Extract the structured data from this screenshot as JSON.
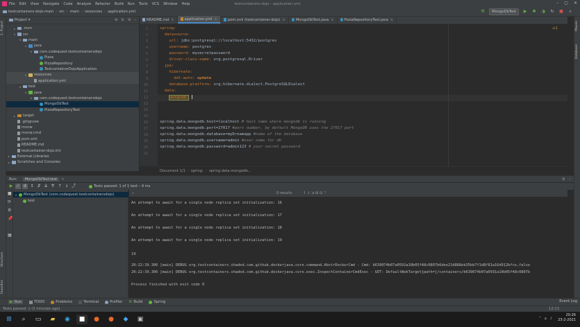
{
  "menubar": {
    "items": [
      "File",
      "Edit",
      "View",
      "Navigate",
      "Code",
      "Analyze",
      "Refactor",
      "Build",
      "Run",
      "Tools",
      "VCS",
      "Window",
      "Help"
    ],
    "window_title": "testcontainers-dojo - application.yml"
  },
  "navbar": {
    "crumbs": [
      "testcontainers-dojo-main",
      "src",
      "main",
      "resources",
      "application.yml"
    ],
    "run_config": "MongoDbTest"
  },
  "project": {
    "title": "Project",
    "tree": [
      {
        "label": ".mvn",
        "depth": 1,
        "icon": "folder"
      },
      {
        "label": "src",
        "depth": 1,
        "icon": "folder"
      },
      {
        "label": "main",
        "depth": 2,
        "icon": "folder"
      },
      {
        "label": "java",
        "depth": 3,
        "icon": "folder-blue"
      },
      {
        "label": "com.codequest.testcontainersdojo",
        "depth": 4,
        "icon": "folder"
      },
      {
        "label": "Pizza",
        "depth": 5,
        "icon": "class"
      },
      {
        "label": "PizzaRepository",
        "depth": 5,
        "icon": "interface"
      },
      {
        "label": "TestcontainerDojoApplication",
        "depth": 5,
        "icon": "class"
      },
      {
        "label": "resources",
        "depth": 3,
        "icon": "folder-yellow"
      },
      {
        "label": "application.yml",
        "depth": 4,
        "icon": "file"
      },
      {
        "label": "test",
        "depth": 2,
        "icon": "folder"
      },
      {
        "label": "java",
        "depth": 3,
        "icon": "folder-green"
      },
      {
        "label": "com.codequest.testcontainersdojo",
        "depth": 4,
        "icon": "folder"
      },
      {
        "label": "MongoDbTest",
        "depth": 5,
        "icon": "class"
      },
      {
        "label": "PizzaRepositoryTest",
        "depth": 5,
        "icon": "class"
      },
      {
        "label": "target",
        "depth": 1,
        "icon": "folder-orange"
      },
      {
        "label": ".gitignore",
        "depth": 1,
        "icon": "file"
      },
      {
        "label": "mvnw",
        "depth": 1,
        "icon": "file"
      },
      {
        "label": "mvnw.cmd",
        "depth": 1,
        "icon": "file"
      },
      {
        "label": "pom.xml",
        "depth": 1,
        "icon": "file"
      },
      {
        "label": "README.md",
        "depth": 1,
        "icon": "file"
      },
      {
        "label": "testcontainer-dojo.iml",
        "depth": 1,
        "icon": "file"
      },
      {
        "label": "External Libraries",
        "depth": 0,
        "icon": "folder"
      },
      {
        "label": "Scratches and Consoles",
        "depth": 0,
        "icon": "folder"
      }
    ]
  },
  "tabs": [
    {
      "label": "README.md"
    },
    {
      "label": "application.yml"
    },
    {
      "label": "pom.xml (testcontainer-dojo)"
    },
    {
      "label": "MongoDbTest.java"
    },
    {
      "label": "PizzaRepositoryTest.java"
    }
  ],
  "editor": {
    "line_numbers": [
      "1",
      "2",
      "3",
      "4",
      "5",
      "6",
      "7",
      "8",
      "9",
      "10",
      "11",
      "12",
      "13",
      "14",
      "15",
      "16",
      "17",
      "18",
      "19",
      "20",
      "21"
    ],
    "l1": "spring:",
    "l2": "  datasource:",
    "l3k": "    url: ",
    "l3v": "jdbc:postgresql://localhost:5432/postgres",
    "l4k": "    username: ",
    "l4v": "postgres",
    "l5k": "    password: ",
    "l5v": "mysecretpassword",
    "l6k": "    driver-class-name: ",
    "l6v": "org.postgresql.Driver",
    "l7": "  jpa:",
    "l8": "    hibernate:",
    "l9k": "      ddl-auto: ",
    "l9v": "update",
    "l10k": "    database-platform: ",
    "l10v": "org.hibernate.dialect.PostgreSQLDialect",
    "l11": "  data:",
    "l12": "mongodb:",
    "p1": "spring.data.mongodb.host=localhost ",
    "c1": "# host name where mongodb is running",
    "p2": "spring.data.mongodb.port=27017 ",
    "c2": "#port number, by default MongoDB uses the 27017 port",
    "p3": "spring.data.mongodb.database=myDreamapp ",
    "c3": "#name of the database",
    "p4": "spring.data.mongodb.username=admin ",
    "c4": "#user name for db",
    "p5": "spring.data.mongodb.password=admin123 ",
    "c5": "# your secret password",
    "warning": "⚠1"
  },
  "breadcrumb": [
    "Document 1/1",
    "spring:",
    "spring.data.mongodb..."
  ],
  "run": {
    "label": "Run:",
    "tab": "MongoDbTest.test",
    "status": "Tests passed: 1 of 1 test – 4 ms",
    "results_label": "0 results",
    "tree_root": "MongoDbTest (com.codequest.testcontainersdojo)",
    "tree_child": "test",
    "console": [
      "An attempt to await for a single node replica set initialization: 16",
      "An attempt to await for a single node replica set initialization: 17",
      "An attempt to await for a single node replica set initialization: 18",
      "An attempt to await for a single node replica set initialization: 19",
      "19",
      "20:22:39.306 [main] DEBUG org.testcontainers.shaded.com.github.dockerjava.core.command.AbstrDockerCmd - Cmd: b639074b07a0591a10b05f48c0807b6dee21d888eb35bb7f1d8f81a16d912bfce,false",
      "20:22:39.306 [main] DEBUG org.testcontainers.shaded.com.github.dockerjava.core.exec.InspectContainerCmdExec - GET: DefaultWebTarget{path=[/containers/b639074b07a0591a10b05f48c0807b",
      "Process finished with exit code 0"
    ]
  },
  "bottom_tabs": [
    "Run",
    "TODO",
    "Problems",
    "Terminal",
    "Profiler",
    "Build",
    "Spring"
  ],
  "event_log": "Event Log",
  "status_text": "Tests passed: 1 (3 minutes ago)",
  "status_right": "12:13",
  "clock": {
    "time": "20:26",
    "date": "23-2-2021"
  },
  "colors": {
    "accent": "#4a88c7",
    "pass": "#62b543",
    "keyword": "#cc7832",
    "string": "#6a8759"
  }
}
